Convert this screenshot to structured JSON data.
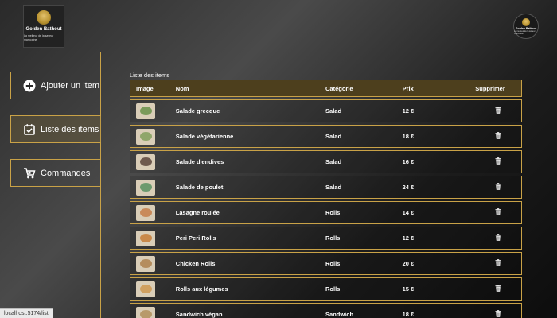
{
  "brand": {
    "name": "Golden Bathout",
    "tagline": "La meilleur de la saveur marocaine"
  },
  "sidebar": {
    "items": [
      {
        "label": "Ajouter un item",
        "icon": "plus-circle-icon",
        "active": false
      },
      {
        "label": "Liste des items",
        "icon": "calendar-check-icon",
        "active": true
      },
      {
        "label": "Commandes",
        "icon": "cart-icon",
        "active": false
      }
    ]
  },
  "list": {
    "title": "Liste des items",
    "headers": {
      "image": "Image",
      "name": "Nom",
      "category": "Catégorie",
      "price": "Prix",
      "delete": "Supprimer"
    },
    "rows": [
      {
        "name": "Salade grecque",
        "category": "Salad",
        "price": "12 €",
        "thumb_color": "#7a9a5a"
      },
      {
        "name": "Salade végétarienne",
        "category": "Salad",
        "price": "18 €",
        "thumb_color": "#8fa66a"
      },
      {
        "name": "Salade d'endives",
        "category": "Salad",
        "price": "16 €",
        "thumb_color": "#6e5a4e"
      },
      {
        "name": "Salade de poulet",
        "category": "Salad",
        "price": "24 €",
        "thumb_color": "#6c9a6e"
      },
      {
        "name": "Lasagne roulée",
        "category": "Rolls",
        "price": "14 €",
        "thumb_color": "#c98a5a"
      },
      {
        "name": "Peri Peri Rolls",
        "category": "Rolls",
        "price": "12 €",
        "thumb_color": "#c9894a"
      },
      {
        "name": "Chicken Rolls",
        "category": "Rolls",
        "price": "20 €",
        "thumb_color": "#b58d5e"
      },
      {
        "name": "Rolls aux légumes",
        "category": "Rolls",
        "price": "15 €",
        "thumb_color": "#d0a060"
      },
      {
        "name": "Sandwich végan",
        "category": "Sandwich",
        "price": "18 €",
        "thumb_color": "#b89a6a"
      }
    ]
  },
  "status_url": "localhost:5174/list",
  "colors": {
    "accent": "#c9a247",
    "header_bg": "#4d3f1d"
  }
}
